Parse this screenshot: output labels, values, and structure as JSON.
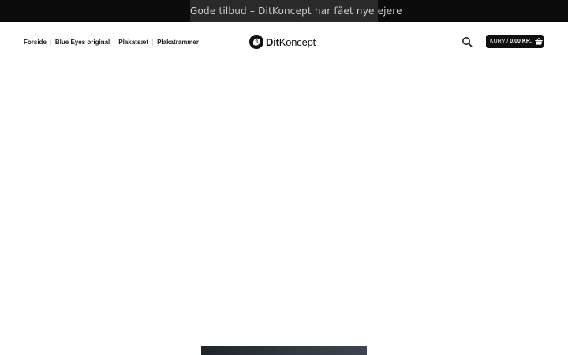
{
  "announcement": {
    "text": "Gode tilbud – DitKoncept har fået nye ejere"
  },
  "nav": {
    "items": [
      {
        "label": "Forside"
      },
      {
        "label": "Blue Eyes original"
      },
      {
        "label": "Plakatsæt"
      },
      {
        "label": "Plakatrammer"
      }
    ]
  },
  "logo": {
    "bold": "Dit",
    "regular": "Koncept",
    "icon": "brain-head-icon"
  },
  "search": {
    "icon": "search-icon"
  },
  "cart": {
    "label": "KURV",
    "separator": "/",
    "total": "0,00 KR.",
    "icon": "basket-icon"
  },
  "colors": {
    "topbar": "#0b0b0b",
    "announce_bg": "#2a2a2a",
    "announce_text": "#cfcfcf",
    "cart_bg": "#0f0f0f"
  }
}
